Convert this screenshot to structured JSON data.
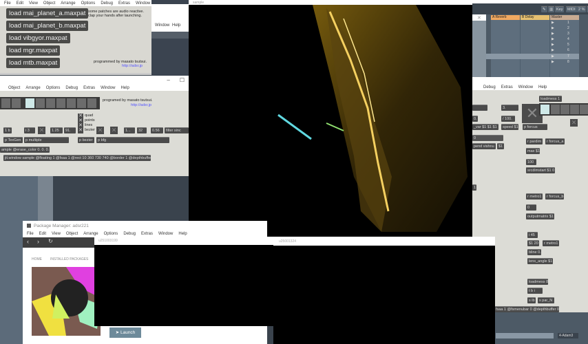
{
  "menus": [
    "File",
    "Edit",
    "View",
    "Object",
    "Arrange",
    "Options",
    "Debug",
    "Extras",
    "Window",
    "Help"
  ],
  "launcher": {
    "buttons": [
      "load mai_planet_a.maxpat",
      "load mai_planet_b.maxpat",
      "load vibgyor.maxpat",
      "load mgr.maxpat",
      "load mtb.maxpat"
    ],
    "note": "some patches are audio reactive. clap your hands after launching.",
    "credit": "programmed by masato tsutsui.",
    "link": "http://adsr.jp"
  },
  "behind_menu": [
    "Window",
    "Help"
  ],
  "patch_left": {
    "credit": "programed by masato tsutsui.",
    "link": "http://adsr.jp",
    "checks": [
      "quad",
      "points",
      "lines",
      "bezier"
    ],
    "row1": [
      "1 b",
      "i 3",
      "1.25",
      "91.",
      "1...",
      "32",
      "0.56",
      "filter sinc"
    ],
    "row2": [
      "p TexGen",
      "p multiple",
      "p bezier",
      "p bfg"
    ],
    "msg1": "ample @erase_color 0. 0. 0. 1",
    "msg2": "jit.window sample @floating 1 @fsaa 1 @rect 10 360 730 740 @border 1 @depthbuffer 0"
  },
  "sample_window": {
    "title": "sample"
  },
  "ableton": {
    "buttons": [
      "Key",
      "MIDI",
      "2 %",
      "D"
    ],
    "tracks": [
      {
        "name": "A Reverb",
        "color": "#f0a860"
      },
      {
        "name": "B Delay",
        "color": "#e6c070"
      },
      {
        "name": "Master",
        "color": "#c9ab92"
      }
    ],
    "scenes": [
      "1",
      "2",
      "3",
      "4",
      "5",
      "6",
      "7",
      "8"
    ],
    "bottom_track": "4-Adam3"
  },
  "patch_right": {
    "objects": [
      "loadmess 1",
      "3.",
      "/ 100.",
      "speed $1",
      "p forcus",
      "_var $1 $1 $1",
      "0.",
      "0",
      "pend vishnu",
      "$1",
      "r pardim",
      "r forcus_a",
      "max $1",
      "100",
      "srcdimstart $1 0",
      "1",
      "r metro1",
      "r forcus_b",
      "0",
      "outputmatrix $1",
      "i 45",
      "$1 20",
      "r metro1",
      "bline 0.",
      "lens_angle $1",
      "loadmess 8",
      "t b i",
      "s ib",
      "s par_N",
      "fsaa 1 @fsmenubar 0 @depthbuffer 0"
    ]
  },
  "package_manager": {
    "title": "Package Manager: adsr221",
    "nav": [
      "HOME",
      "INSTALLED PACKAGES"
    ],
    "launch": "Launch"
  },
  "black_windows": [
    {
      "title": "u251003199"
    },
    {
      "title": "u25001324"
    }
  ]
}
